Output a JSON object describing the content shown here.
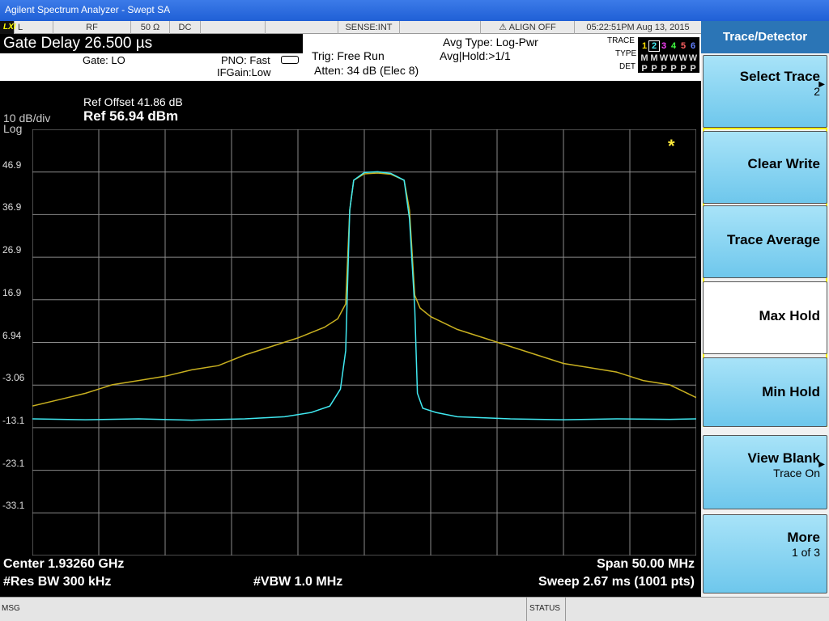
{
  "window": {
    "title": "Agilent Spectrum Analyzer - Swept SA"
  },
  "status_strip": {
    "lxi": "LXI",
    "coupling": "L",
    "input": "RF",
    "impedance": "50 Ω",
    "dc": "DC",
    "sense": "SENSE:INT",
    "align": "ALIGN OFF",
    "timestamp": "05:22:51PM Aug 13, 2015"
  },
  "info": {
    "gate_delay": "Gate Delay 26.500 µs",
    "gate": "Gate: LO",
    "pno": "PNO: Fast",
    "ifgain": "IFGain:Low",
    "trig": "Trig: Free Run",
    "atten": "Atten: 34 dB (Elec 8)",
    "avg_type": "Avg Type: Log-Pwr",
    "avg_hold": "Avg|Hold:>1/1",
    "trace_label": "TRACE",
    "type_label": "TYPE",
    "det_label": "DET",
    "trace_numbers": [
      "1",
      "2",
      "3",
      "4",
      "5",
      "6"
    ],
    "type_values": [
      "M",
      "M",
      "W",
      "W",
      "W",
      "W"
    ],
    "det_values": [
      "P",
      "P",
      "P",
      "P",
      "P",
      "P"
    ]
  },
  "plot": {
    "scale_per_div": "10 dB/div",
    "scale_type": "Log",
    "ref_offset": "Ref Offset 41.86 dB",
    "ref_level": "Ref 56.94 dBm",
    "y_ticks": [
      "46.9",
      "36.9",
      "26.9",
      "16.9",
      "6.94",
      "-3.06",
      "-13.1",
      "-23.1",
      "-33.1"
    ],
    "center": "Center 1.93260 GHz",
    "res_bw": "#Res BW 300 kHz",
    "vbw": "#VBW 1.0 MHz",
    "span": "Span 50.00 MHz",
    "sweep": "Sweep  2.67 ms (1001 pts)",
    "marker_star": "*"
  },
  "chart_data": {
    "type": "line",
    "x_range": [
      1.9076,
      1.9576
    ],
    "y_range": [
      -43.06,
      56.94
    ],
    "grid": true,
    "series": [
      {
        "color": "#c8b020",
        "points": [
          [
            1.9076,
            -8.0
          ],
          [
            1.9096,
            -6.5
          ],
          [
            1.9116,
            -5.0
          ],
          [
            1.9136,
            -3.0
          ],
          [
            1.9156,
            -2.0
          ],
          [
            1.9176,
            -1.0
          ],
          [
            1.9196,
            0.5
          ],
          [
            1.9216,
            1.5
          ],
          [
            1.9236,
            4.0
          ],
          [
            1.9256,
            6.0
          ],
          [
            1.9276,
            8.0
          ],
          [
            1.9296,
            10.5
          ],
          [
            1.9306,
            12.5
          ],
          [
            1.9312,
            16.0
          ],
          [
            1.9315,
            38.0
          ],
          [
            1.9318,
            45.0
          ],
          [
            1.9326,
            46.5
          ],
          [
            1.9336,
            46.7
          ],
          [
            1.9346,
            46.4
          ],
          [
            1.9356,
            45.0
          ],
          [
            1.936,
            38.0
          ],
          [
            1.9364,
            18.0
          ],
          [
            1.9368,
            15.0
          ],
          [
            1.9376,
            13.0
          ],
          [
            1.9396,
            10.0
          ],
          [
            1.9416,
            8.0
          ],
          [
            1.9436,
            6.0
          ],
          [
            1.9456,
            4.0
          ],
          [
            1.9476,
            2.0
          ],
          [
            1.9496,
            1.0
          ],
          [
            1.9516,
            0.0
          ],
          [
            1.9536,
            -2.0
          ],
          [
            1.9556,
            -3.0
          ],
          [
            1.9576,
            -6.0
          ]
        ]
      },
      {
        "color": "#40e8f0",
        "points": [
          [
            1.9076,
            -11.0
          ],
          [
            1.9116,
            -11.2
          ],
          [
            1.9156,
            -11.0
          ],
          [
            1.9196,
            -11.3
          ],
          [
            1.9236,
            -11.0
          ],
          [
            1.9266,
            -10.5
          ],
          [
            1.9286,
            -9.5
          ],
          [
            1.93,
            -8.0
          ],
          [
            1.9308,
            -4.0
          ],
          [
            1.9312,
            5.0
          ],
          [
            1.9315,
            38.0
          ],
          [
            1.9318,
            45.0
          ],
          [
            1.9326,
            46.8
          ],
          [
            1.9336,
            47.0
          ],
          [
            1.9346,
            46.6
          ],
          [
            1.9356,
            45.0
          ],
          [
            1.936,
            36.0
          ],
          [
            1.9364,
            15.0
          ],
          [
            1.9366,
            -5.0
          ],
          [
            1.937,
            -8.5
          ],
          [
            1.938,
            -9.5
          ],
          [
            1.9396,
            -10.5
          ],
          [
            1.9436,
            -11.0
          ],
          [
            1.9476,
            -11.2
          ],
          [
            1.9516,
            -11.0
          ],
          [
            1.9556,
            -11.1
          ],
          [
            1.9576,
            -11.0
          ]
        ]
      }
    ]
  },
  "softkeys": {
    "title": "Trace/Detector",
    "keys": [
      {
        "label": "Select Trace",
        "sub": "2"
      },
      {
        "label": "Clear Write",
        "sub": ""
      },
      {
        "label": "Trace Average",
        "sub": ""
      },
      {
        "label": "Max Hold",
        "sub": ""
      },
      {
        "label": "Min Hold",
        "sub": ""
      },
      {
        "label": "View Blank",
        "sub": "Trace On"
      },
      {
        "label": "More",
        "sub": "1 of 3"
      }
    ]
  },
  "message_bar": {
    "msg": "MSG",
    "status": "STATUS"
  }
}
